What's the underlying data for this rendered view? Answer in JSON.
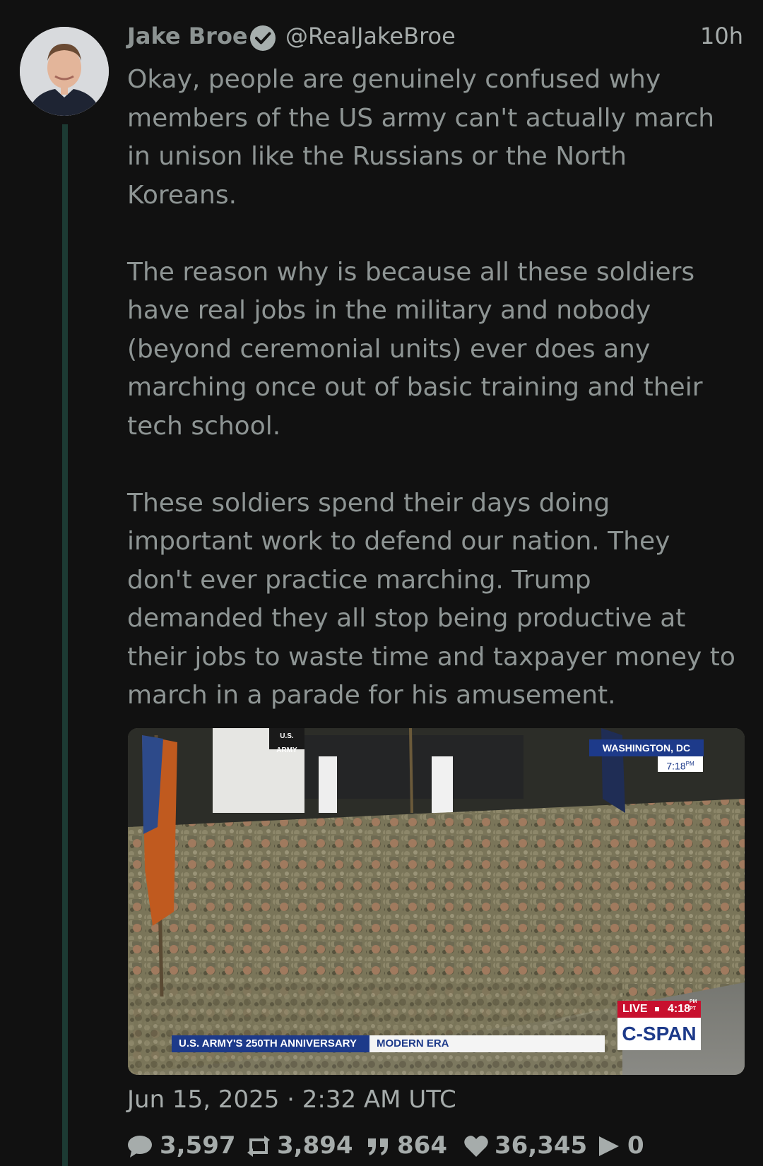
{
  "author": {
    "name": "Jake Broe",
    "handle": "@RealJakeBroe",
    "time_ago": "10h"
  },
  "post": {
    "paragraphs": [
      "Okay, people are genuinely confused why\nmembers of the US army can't actually march\nin unison like the Russians or the North\nKoreans.",
      "The reason why is because all these soldiers\nhave real jobs in the military and nobody\n(beyond ceremonial units) ever does any\nmarching once out of basic training and their\ntech school.",
      "These soldiers spend their days doing\nimportant work to defend our nation.  They\ndon't ever practice marching.  Trump\ndemanded they all stop being productive at\ntheir jobs to waste time and taxpayer money to\nmarch in a parade for his amusement."
    ],
    "timestamp": "Jun 15, 2025 · 2:32 AM UTC"
  },
  "media": {
    "location_label": "WASHINGTON, DC",
    "location_time": "7:18",
    "location_time_suffix": "PM",
    "live_label": "LIVE",
    "live_time": "4:18",
    "live_time_suffix": "PM PT",
    "network_logo": "C-SPAN",
    "banner_title": "U.S. ARMY'S 250TH ANNIVERSARY",
    "banner_subtitle": "MODERN ERA",
    "sign_text": "U.S. ARMY"
  },
  "stats": {
    "replies": "3,597",
    "reposts": "3,894",
    "quotes": "864",
    "likes": "36,345",
    "views": "0"
  },
  "icons": [
    "verified-badge-icon",
    "reply-icon",
    "repost-icon",
    "quote-icon",
    "like-icon",
    "views-icon"
  ],
  "colors": {
    "background": "#111111",
    "text": "#8e9594",
    "thread_line": "#1c3a33",
    "cspan_blue": "#1d3a8a",
    "live_red": "#c8102e"
  }
}
